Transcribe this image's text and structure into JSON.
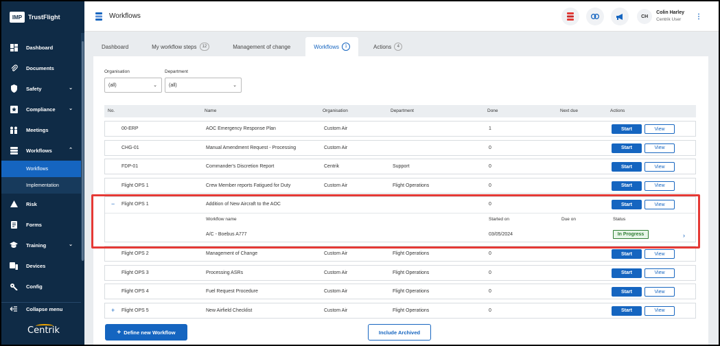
{
  "app": {
    "brand_logo": "IMP",
    "brand_name": "TrustFlight",
    "footer_brand": "Centrik"
  },
  "sidebar": {
    "items": [
      {
        "label": "Dashboard",
        "icon": "dashboard-icon"
      },
      {
        "label": "Documents",
        "icon": "paperclip-icon"
      },
      {
        "label": "Safety",
        "icon": "shield-icon",
        "has_chevron": true
      },
      {
        "label": "Compliance",
        "icon": "star-icon",
        "has_chevron": true
      },
      {
        "label": "Meetings",
        "icon": "people-icon"
      },
      {
        "label": "Workflows",
        "icon": "workflow-icon",
        "has_chevron": true,
        "expanded": true
      },
      {
        "label": "Risk",
        "icon": "warning-icon"
      },
      {
        "label": "Forms",
        "icon": "forms-icon"
      },
      {
        "label": "Training",
        "icon": "graduation-cap-icon",
        "has_chevron": true
      },
      {
        "label": "Devices",
        "icon": "devices-icon"
      },
      {
        "label": "Config",
        "icon": "config-icon"
      }
    ],
    "subitems": [
      {
        "label": "Workflows",
        "active": true
      },
      {
        "label": "Implementation",
        "active": false
      }
    ],
    "collapse_label": "Collapse menu"
  },
  "header": {
    "title": "Workflows",
    "user_initials": "CH",
    "user_name": "Colin Harley",
    "user_role": "Centrik User"
  },
  "tabs": [
    {
      "label": "Dashboard",
      "count": null,
      "active": false
    },
    {
      "label": "My workflow steps",
      "count": "12",
      "active": false
    },
    {
      "label": "Management of change",
      "count": null,
      "active": false
    },
    {
      "label": "Workflows",
      "count": "1",
      "active": true
    },
    {
      "label": "Actions",
      "count": "4",
      "active": false
    }
  ],
  "filters": {
    "organisation_label": "Organisation",
    "organisation_value": "(all)",
    "department_label": "Department",
    "department_value": "(all)"
  },
  "table": {
    "headers": {
      "no": "No.",
      "name": "Name",
      "organisation": "Organisation",
      "department": "Department",
      "done": "Done",
      "next_due": "Next due",
      "actions": "Actions"
    },
    "start_label": "Start",
    "view_label": "View",
    "rows": [
      {
        "no": "00-ERP",
        "name": "AOC Emergency Response Plan",
        "organisation": "Custom Air",
        "department": "",
        "done": "1",
        "expander": ""
      },
      {
        "no": "CHG-01",
        "name": "Manual Amendment Request - Processing",
        "organisation": "Custom Air",
        "department": "",
        "done": "0",
        "expander": ""
      },
      {
        "no": "FDP-01",
        "name": "Commander's Discretion Report",
        "organisation": "Centrik",
        "department": "Support",
        "done": "0",
        "expander": ""
      },
      {
        "no": "Flight OPS 1",
        "name": "Crew Member reports Fatigued for Duty",
        "organisation": "Custom Air",
        "department": "Flight Operations",
        "done": "0",
        "expander": ""
      }
    ],
    "expanded_row": {
      "expander": "−",
      "no": "Flight OPS 1",
      "name": "Addition of New Aircraft to the AOC",
      "done": "0",
      "sub_headers": {
        "workflow_name": "Workflow name",
        "started_on": "Started on",
        "due_on": "Due on",
        "status": "Status"
      },
      "instance": {
        "workflow_name": "A/C - Boebus A777",
        "started_on": "03/05/2024",
        "due_on": "",
        "status": "In Progress"
      }
    },
    "rows_after": [
      {
        "no": "Flight OPS 2",
        "name": "Management of Change",
        "organisation": "Custom Air",
        "department": "Flight Operations",
        "done": "0",
        "expander": ""
      },
      {
        "no": "Flight OPS 3",
        "name": "Processing ASRs",
        "organisation": "Custom Air",
        "department": "Flight Operations",
        "done": "0",
        "expander": ""
      },
      {
        "no": "Flight OPS 4",
        "name": "Fuel Request Procedure",
        "organisation": "Custom Air",
        "department": "Flight Operations",
        "done": "0",
        "expander": ""
      },
      {
        "no": "Flight OPS 5",
        "name": "New Airfield Checklist",
        "organisation": "Custom Air",
        "department": "Flight Operations",
        "done": "0",
        "expander": "+"
      }
    ]
  },
  "buttons": {
    "define_new": "Define new Workflow",
    "include_archived": "Include Archived"
  },
  "colors": {
    "sidebar_bg": "#0f2b46",
    "primary": "#1565c0",
    "active_sub": "#1565c0",
    "highlight": "#e53935",
    "status_green": "#2e7d32"
  }
}
